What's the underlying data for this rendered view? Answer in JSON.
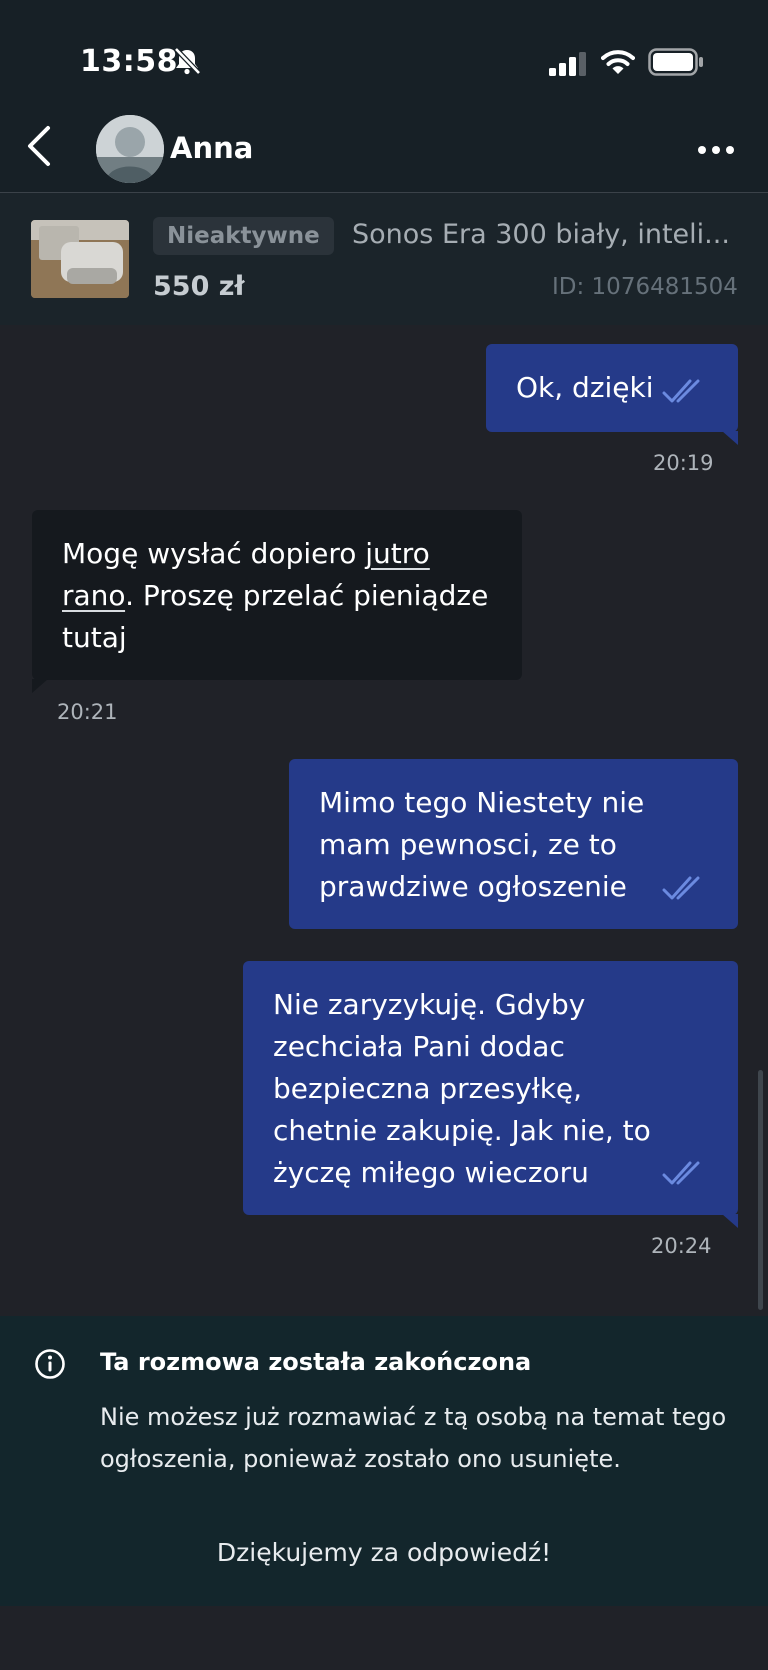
{
  "status_bar": {
    "time": "13:58"
  },
  "header": {
    "contact_name": "Anna"
  },
  "listing": {
    "status_badge": "Nieaktywne",
    "title": "Sonos Era 300 biały, inteli...",
    "price": "550 zł",
    "id_label": "ID: 1076481504"
  },
  "messages": [
    {
      "direction": "out",
      "text": "Ok, dzięki",
      "time": "20:19"
    },
    {
      "direction": "in",
      "text_before_link": "Mogę wysłać dopiero ",
      "link": "jutro rano",
      "text_after_link": ". Proszę przelać pieniądze tutaj",
      "time": "20:21"
    },
    {
      "direction": "out",
      "text": "Mimo tego Niestety nie mam pewnosci, ze to prawdziwe ogłoszenie"
    },
    {
      "direction": "out",
      "text": "Nie zaryzykuję. Gdyby zechciała Pani dodac bezpieczna przesyłkę, chetnie zakupię. Jak nie, to życzę miłego wieczoru",
      "time": "20:24"
    }
  ],
  "footer": {
    "title": "Ta rozmowa została zakończona",
    "text": "Nie możesz już rozmawiać z tą osobą na temat tego ogłoszenia, ponieważ zostało ono usunięte.",
    "thanks": "Dziękujemy za odpowiedź!"
  },
  "colors": {
    "background": "#202228",
    "header": "#172026",
    "outgoing_bubble": "#253a89",
    "incoming_bubble": "#15191e",
    "read_ticks": "#6b8ae0",
    "footer": "#13262c"
  },
  "icons": [
    "back-arrow-icon",
    "bell-muted-icon",
    "signal-icon",
    "wifi-icon",
    "battery-icon",
    "more-icon",
    "double-check-icon",
    "info-icon"
  ]
}
